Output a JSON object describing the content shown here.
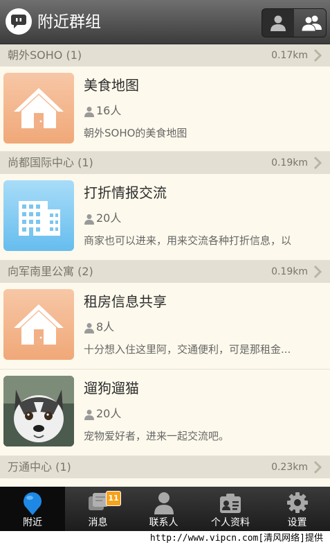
{
  "header": {
    "title": "附近群组",
    "logo_icon": "chat-bubble-icon",
    "toggle": [
      {
        "icon": "single-person-icon",
        "active": false
      },
      {
        "icon": "group-people-icon",
        "active": true
      }
    ]
  },
  "sections": [
    {
      "name": "朝外SOHO (1)",
      "distance": "0.17km",
      "groups": [
        {
          "name": "美食地图",
          "members": "16人",
          "desc": "朝外SOHO的美食地图",
          "thumb": "home-icon"
        }
      ]
    },
    {
      "name": "尚都国际中心 (1)",
      "distance": "0.19km",
      "groups": [
        {
          "name": "打折情报交流",
          "members": "20人",
          "desc": "商家也可以进来，用来交流各种打折信息，以",
          "thumb": "office-building-icon"
        }
      ]
    },
    {
      "name": "向军南里公寓 (2)",
      "distance": "0.19km",
      "groups": [
        {
          "name": "租房信息共享",
          "members": "8人",
          "desc": "十分想入住这里阿，交通便利，可是那租金...",
          "thumb": "home-icon"
        },
        {
          "name": "遛狗遛猫",
          "members": "20人",
          "desc": "宠物爱好者，进来一起交流吧。",
          "thumb": "husky-photo"
        }
      ]
    },
    {
      "name": "万通中心 (1)",
      "distance": "0.23km",
      "groups": []
    }
  ],
  "tabs": [
    {
      "label": "附近",
      "icon": "location-pin-icon",
      "active": true
    },
    {
      "label": "消息",
      "icon": "message-icon",
      "badge": "11"
    },
    {
      "label": "联系人",
      "icon": "contacts-icon"
    },
    {
      "label": "个人资料",
      "icon": "profile-card-icon"
    },
    {
      "label": "设置",
      "icon": "gear-icon"
    }
  ],
  "watermark": "http://www.vipcn.com[清风网络]提供",
  "colors": {
    "header_dark": "#3c3c3c",
    "list_bg": "#fbf7ea",
    "section_bg": "#e3dfd2",
    "badge": "#f6a21b",
    "accent_blue": "#1e88e5"
  }
}
